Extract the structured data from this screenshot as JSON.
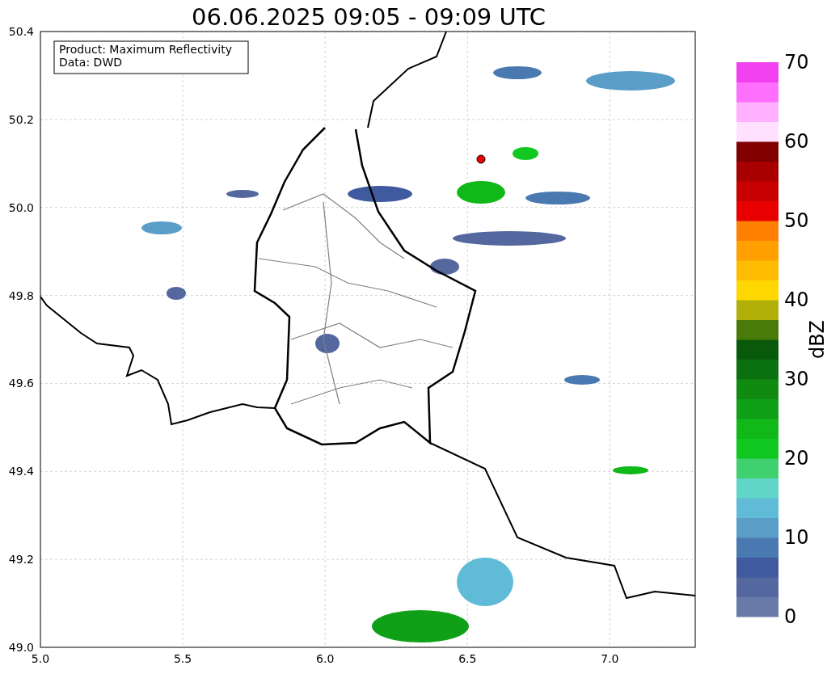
{
  "title": "06.06.2025 09:05 - 09:09 UTC",
  "legend": [
    "Product: Maximum Reflectivity",
    "Data: DWD"
  ],
  "x_ticks": [
    "5.0",
    "5.5",
    "6.0",
    "6.5",
    "7.0"
  ],
  "y_ticks": [
    "50.4",
    "50.2",
    "50.0",
    "49.8",
    "49.6",
    "49.4",
    "49.2",
    "49.0"
  ],
  "colorbar": {
    "label": "dBZ",
    "ticks": [
      "70",
      "60",
      "50",
      "40",
      "30",
      "20",
      "10",
      "0"
    ],
    "segments": [
      {
        "color": "#6a7aa8"
      },
      {
        "color": "#55679f"
      },
      {
        "color": "#3f5a9e"
      },
      {
        "color": "#4a78b0"
      },
      {
        "color": "#5a9ec8"
      },
      {
        "color": "#5fbbd6"
      },
      {
        "color": "#60d5c8"
      },
      {
        "color": "#40d070"
      },
      {
        "color": "#10c820"
      },
      {
        "color": "#10b818"
      },
      {
        "color": "#10a018"
      },
      {
        "color": "#108a10"
      },
      {
        "color": "#0a7010"
      },
      {
        "color": "#085a0a"
      },
      {
        "color": "#4a7a08"
      },
      {
        "color": "#b0b008"
      },
      {
        "color": "#ffd700"
      },
      {
        "color": "#ffbb00"
      },
      {
        "color": "#ffa000"
      },
      {
        "color": "#ff8000"
      },
      {
        "color": "#e80000"
      },
      {
        "color": "#c80000"
      },
      {
        "color": "#a80000"
      },
      {
        "color": "#800000"
      },
      {
        "color": "#ffe0ff"
      },
      {
        "color": "#ffb0ff"
      },
      {
        "color": "#ff70ff"
      },
      {
        "color": "#f040f0"
      }
    ]
  }
}
